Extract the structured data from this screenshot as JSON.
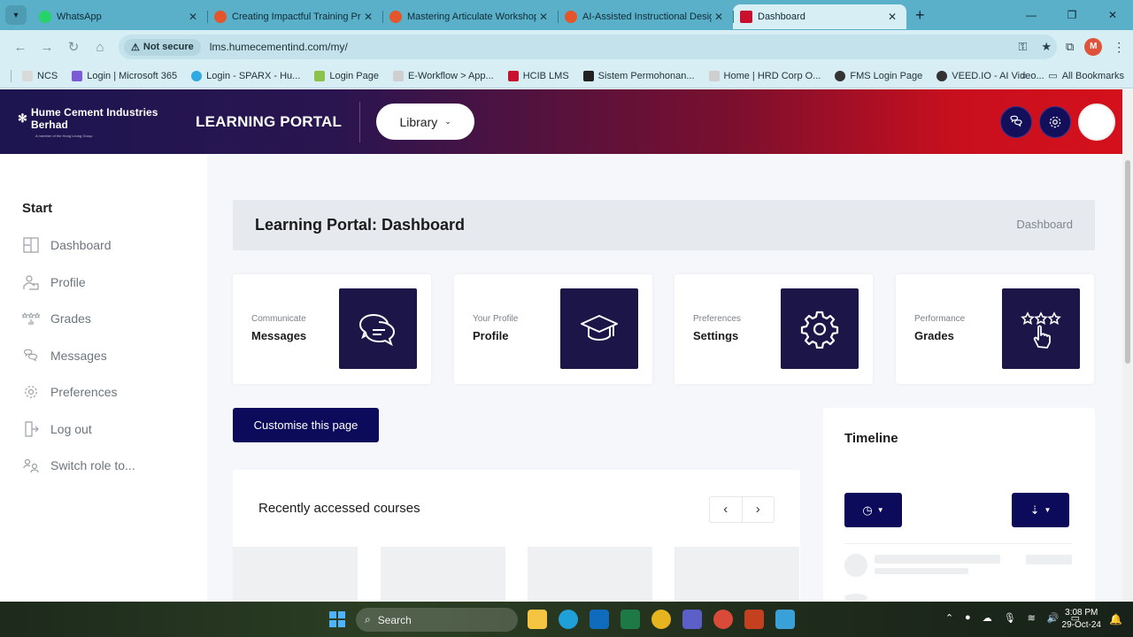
{
  "browser": {
    "tabs": [
      {
        "title": "WhatsApp",
        "color": "#25d366",
        "active": false
      },
      {
        "title": "Creating Impactful Training Pro",
        "color": "#e4552c",
        "active": false
      },
      {
        "title": "Mastering Articulate Workshop",
        "color": "#e4552c",
        "active": false
      },
      {
        "title": "AI-Assisted Instructional Design",
        "color": "#e4552c",
        "active": false
      },
      {
        "title": "Dashboard",
        "color": "#c8102e",
        "active": true
      }
    ],
    "security_label": "Not secure",
    "url": "lms.humecementind.com/my/",
    "profile_initial": "M",
    "bookmarks": [
      {
        "label": "NCS",
        "color": "#d9d9d9"
      },
      {
        "label": "Login | Microsoft 365",
        "color": "#7b5cd6"
      },
      {
        "label": "Login - SPARX - Hu...",
        "color": "#2fa9e0"
      },
      {
        "label": "Login Page",
        "color": "#8bc34a"
      },
      {
        "label": "E-Workflow > App...",
        "color": "#cfcfcf"
      },
      {
        "label": "HCIB LMS",
        "color": "#c8102e"
      },
      {
        "label": "Sistem Permohonan...",
        "color": "#222222"
      },
      {
        "label": "Home | HRD Corp O...",
        "color": "#cfcfcf"
      },
      {
        "label": "FMS Login Page",
        "color": "#333333"
      },
      {
        "label": "VEED.IO - AI Video...",
        "color": "#333333"
      }
    ],
    "all_bookmarks": "All Bookmarks"
  },
  "header": {
    "company": "Hume Cement Industries Berhad",
    "company_tagline": "A member of the Hong Leong Group",
    "portal_title": "LEARNING PORTAL",
    "library_label": "Library"
  },
  "sidebar": {
    "heading": "Start",
    "items": [
      {
        "label": "Dashboard",
        "icon": "puzzle-icon"
      },
      {
        "label": "Profile",
        "icon": "profile-icon"
      },
      {
        "label": "Grades",
        "icon": "grades-icon"
      },
      {
        "label": "Messages",
        "icon": "messages-icon"
      },
      {
        "label": "Preferences",
        "icon": "gear-icon"
      },
      {
        "label": "Log out",
        "icon": "logout-icon"
      },
      {
        "label": "Switch role to...",
        "icon": "switch-role-icon"
      }
    ]
  },
  "main": {
    "page_title": "Learning Portal: Dashboard",
    "breadcrumb": "Dashboard",
    "cards": [
      {
        "sub": "Communicate",
        "title": "Messages",
        "icon": "chat-bubbles-icon"
      },
      {
        "sub": "Your Profile",
        "title": "Profile",
        "icon": "graduation-cap-icon"
      },
      {
        "sub": "Preferences",
        "title": "Settings",
        "icon": "gear-icon"
      },
      {
        "sub": "Performance",
        "title": "Grades",
        "icon": "stars-hand-icon"
      }
    ],
    "customise_label": "Customise this page",
    "recent_title": "Recently accessed courses",
    "timeline_title": "Timeline"
  },
  "taskbar": {
    "search_label": "Search",
    "time": "3:08 PM",
    "date": "29-Oct-24"
  },
  "colors": {
    "navy": "#0c0a5a",
    "card_icon_bg": "#1c1648",
    "header_start": "#1c1550",
    "header_end": "#d4101c"
  }
}
